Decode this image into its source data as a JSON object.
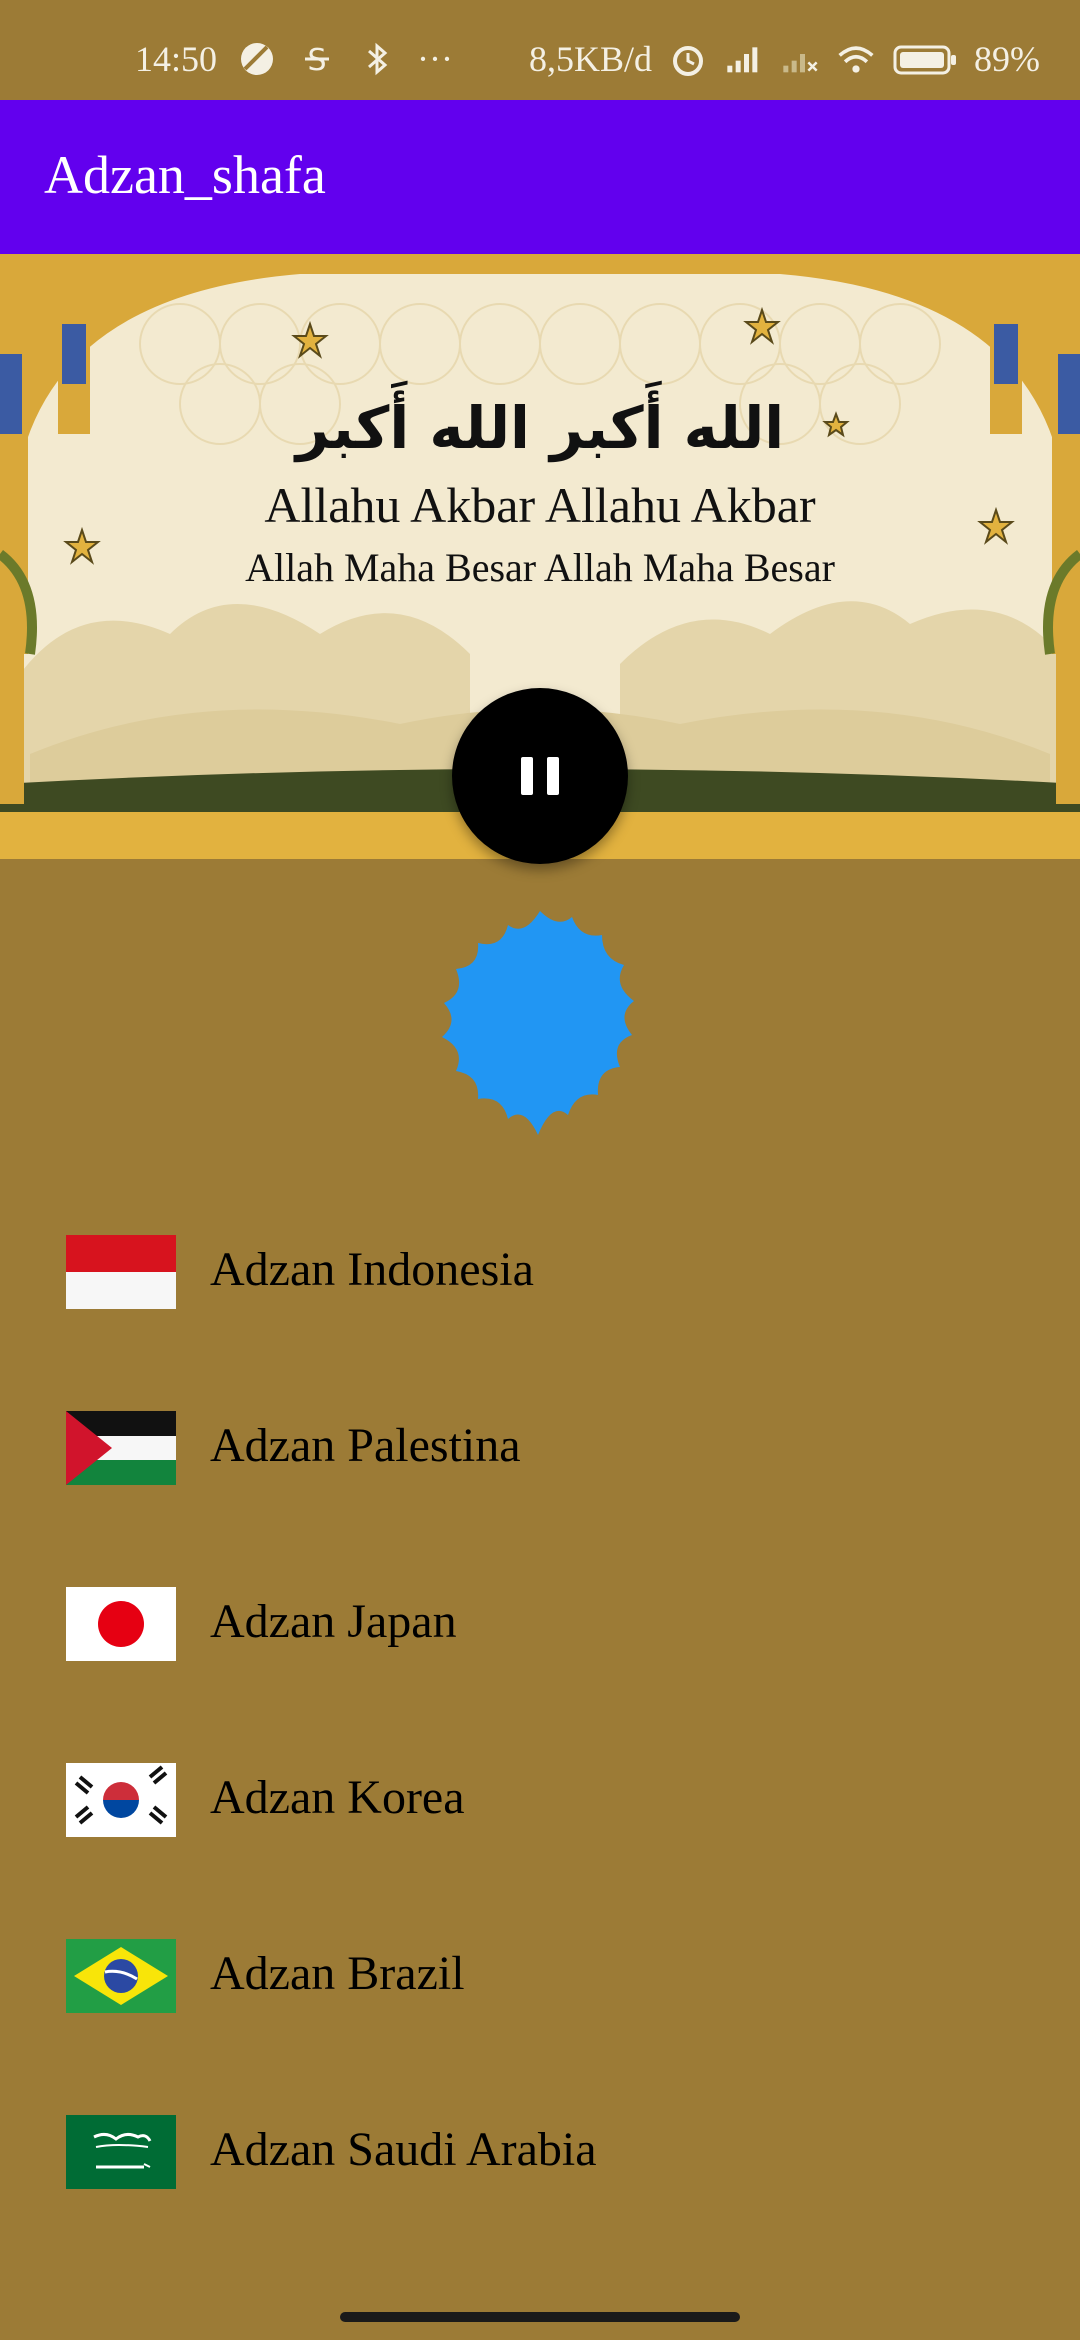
{
  "status_bar": {
    "time": "14:50",
    "network_speed": "8,5KB/d",
    "battery": "89%",
    "more": "···"
  },
  "app_bar": {
    "title": "Adzan_shafa"
  },
  "banner": {
    "arabic": "الله أَكبر الله أَكبر",
    "latin": "Allahu Akbar Allahu Akbar",
    "meaning": "Allah Maha Besar Allah Maha Besar"
  },
  "player": {
    "state_icon": "pause-icon"
  },
  "adzan_list": [
    {
      "label": "Adzan Indonesia",
      "flag": "indonesia-flag"
    },
    {
      "label": "Adzan Palestina",
      "flag": "palestine-flag"
    },
    {
      "label": "Adzan Japan",
      "flag": "japan-flag"
    },
    {
      "label": "Adzan Korea",
      "flag": "korea-flag"
    },
    {
      "label": "Adzan Brazil",
      "flag": "brazil-flag"
    },
    {
      "label": "Adzan Saudi Arabia",
      "flag": "saudi-arabia-flag"
    }
  ],
  "colors": {
    "app_bar": "#6200ee",
    "background": "#9c7b36",
    "blob": "#2196f3"
  }
}
